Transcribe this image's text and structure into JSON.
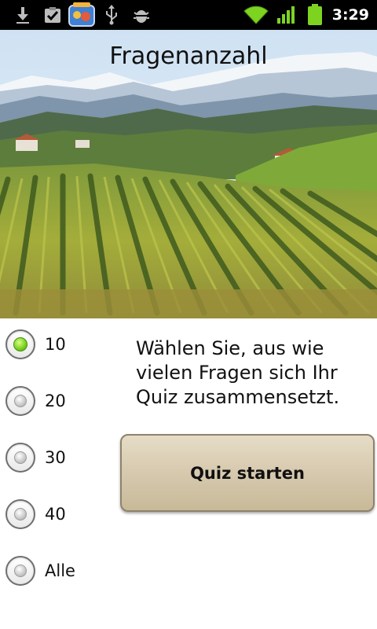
{
  "status_bar": {
    "time": "3:29",
    "icons": [
      "download-icon",
      "clipboard-check-icon",
      "app-notification-icon",
      "usb-icon",
      "android-debug-icon",
      "wifi-icon",
      "signal-icon",
      "battery-icon"
    ],
    "battery_color": "#7ed321"
  },
  "header": {
    "title": "Fragenanzahl"
  },
  "options": [
    {
      "label": "10",
      "selected": true
    },
    {
      "label": "20",
      "selected": false
    },
    {
      "label": "30",
      "selected": false
    },
    {
      "label": "40",
      "selected": false
    },
    {
      "label": "Alle",
      "selected": false
    }
  ],
  "description": "Wählen Sie, aus wie vielen Fragen sich Ihr Quiz zusammensetzt.",
  "start_button": {
    "label": "Quiz starten"
  },
  "colors": {
    "radio_selected": "#7ed321",
    "button_fill": "#d6c9ae",
    "button_border": "#8e826d"
  }
}
